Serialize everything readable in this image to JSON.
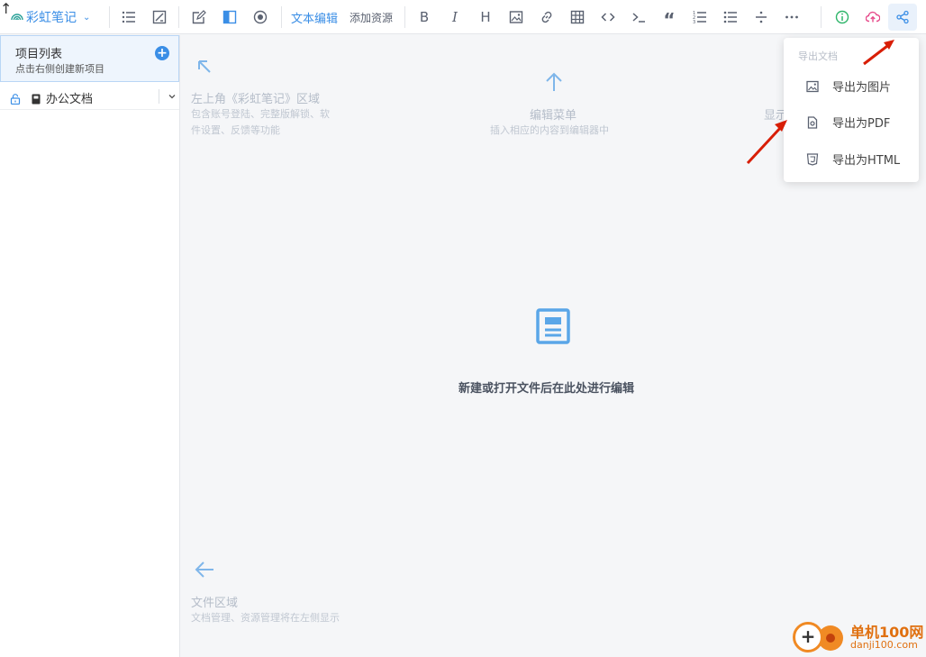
{
  "toolbar": {
    "brand": "彩虹笔记",
    "tabs": [
      "文本编辑",
      "添加资源"
    ],
    "tool_icons": [
      "bold-icon",
      "italic-icon",
      "heading-icon",
      "image-icon",
      "link-icon",
      "table-icon",
      "code-icon",
      "terminal-icon",
      "quote-icon",
      "ordered-list-icon",
      "bullet-list-icon",
      "divider-icon",
      "more-icon"
    ],
    "right_icons": [
      "info-icon",
      "cloud-upload-icon",
      "share-icon"
    ],
    "colors": {
      "accent": "#3a8ee6",
      "info": "#2fb56a",
      "upload": "#e64a8a"
    }
  },
  "sidebar": {
    "title": "项目列表",
    "subtitle": "点击右侧创建新项目",
    "add_label": "+",
    "items": [
      {
        "label": "办公文档"
      }
    ]
  },
  "hints": {
    "top_left_title": "左上角《彩虹笔记》区域",
    "top_left_sub1": "包含账号登陆、完整版解锁、软",
    "top_left_sub2": "件设置、反馈等功能",
    "edit_menu_title": "编辑菜单",
    "edit_menu_sub": "插入相应的内容到编辑器中",
    "right_partial": "显示",
    "file_area_title": "文件区域",
    "file_area_sub": "文档管理、资源管理将在左侧显示"
  },
  "main": {
    "placeholder": "新建或打开文件后在此处进行编辑"
  },
  "export_menu": {
    "header": "导出文档",
    "items": [
      {
        "label": "导出为图片",
        "icon": "image-icon"
      },
      {
        "label": "导出为PDF",
        "icon": "pdf-file-icon"
      },
      {
        "label": "导出为HTML",
        "icon": "html5-icon"
      }
    ]
  },
  "watermark": {
    "name": "单机100网",
    "url": "danji100.com"
  }
}
